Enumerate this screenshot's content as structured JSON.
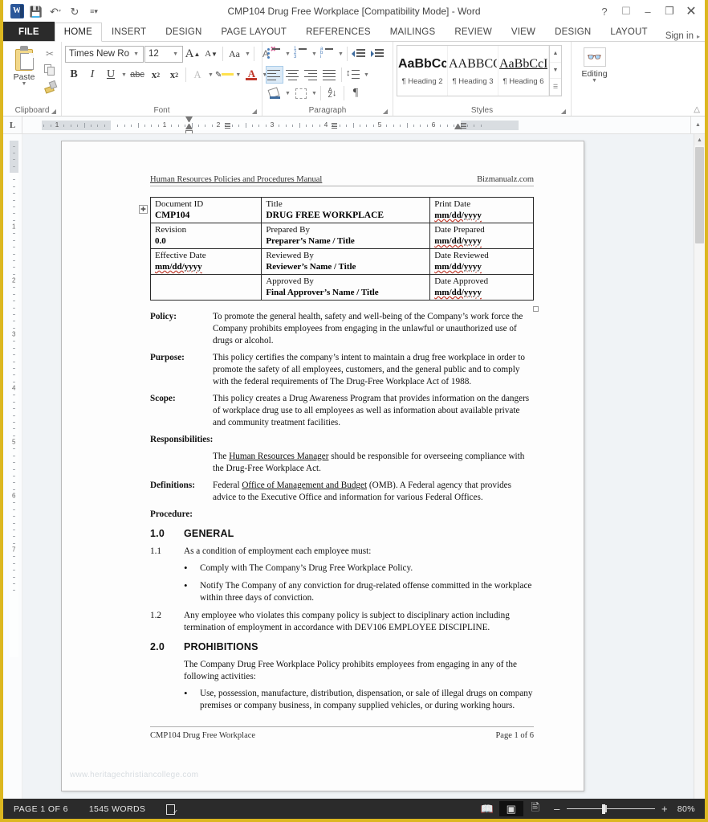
{
  "window": {
    "title": "CMP104 Drug Free Workplace [Compatibility Mode] - Word",
    "qat": {
      "logo": "word-logo",
      "save": "save-icon",
      "undo": "undo-icon",
      "redo": "redo-icon",
      "customize": "customize-qat-icon"
    },
    "controls": {
      "help": "?",
      "ribbon_display": "ribbon-display-options-icon",
      "minimize": "–",
      "restore": "restore-icon",
      "close": "✕"
    }
  },
  "tabs": [
    {
      "label": "FILE",
      "id": "file"
    },
    {
      "label": "HOME",
      "id": "home"
    },
    {
      "label": "INSERT",
      "id": "insert"
    },
    {
      "label": "DESIGN",
      "id": "design"
    },
    {
      "label": "PAGE LAYOUT",
      "id": "page-layout"
    },
    {
      "label": "REFERENCES",
      "id": "references"
    },
    {
      "label": "MAILINGS",
      "id": "mailings"
    },
    {
      "label": "REVIEW",
      "id": "review"
    },
    {
      "label": "VIEW",
      "id": "view"
    },
    {
      "label": "DESIGN",
      "id": "table-design"
    },
    {
      "label": "LAYOUT",
      "id": "table-layout"
    }
  ],
  "active_tab": "HOME",
  "signin": "Sign in",
  "ribbon": {
    "clipboard": {
      "label": "Clipboard",
      "paste": "Paste",
      "cut": "cut-icon",
      "copy": "copy-icon",
      "format_painter": "format-painter-icon"
    },
    "font": {
      "label": "Font",
      "font_name": "Times New Ro",
      "font_size": "12",
      "grow": "A",
      "shrink": "A",
      "change_case": "Aa",
      "clear_formatting": "clear-formatting-icon",
      "bold": "B",
      "italic": "I",
      "underline": "U",
      "strikethrough": "abc",
      "subscript": "x",
      "superscript": "x",
      "text_effects": "A",
      "highlight": "highlight-icon",
      "font_color": "A"
    },
    "paragraph": {
      "label": "Paragraph",
      "bullets": "bullets-icon",
      "numbering": "numbering-icon",
      "multilevel": "multilevel-list-icon",
      "decrease_indent": "decrease-indent-icon",
      "increase_indent": "increase-indent-icon",
      "align_left": "align-left-icon",
      "align_center": "align-center-icon",
      "align_right": "align-right-icon",
      "justify": "justify-icon",
      "line_spacing": "line-spacing-icon",
      "shading": "shading-icon",
      "borders": "borders-icon",
      "sort": "sort-icon",
      "show_marks": "¶"
    },
    "styles": {
      "label": "Styles",
      "items": [
        {
          "preview": "AaBbCc",
          "name": "¶ Heading 2"
        },
        {
          "preview": "AABBCC",
          "name": "¶ Heading 3"
        },
        {
          "preview": "AaBbCcI",
          "name": "¶ Heading 6"
        }
      ]
    },
    "editing": {
      "label": "Editing",
      "icon": "find-binoculars-icon"
    },
    "collapse": "collapse-ribbon-icon"
  },
  "ruler": {
    "tab_selector": "L",
    "h_numbers": [
      "1",
      "1",
      "2",
      "3",
      "4",
      "5"
    ],
    "v_numbers": [
      "1",
      "1",
      "2",
      "3",
      "4",
      "5",
      "6",
      "7",
      "8"
    ]
  },
  "document": {
    "header": {
      "left": "Human Resources Policies and Procedures Manual",
      "right": "Bizmanualz.com"
    },
    "watermark": "www.heritagechristiancollege.com",
    "table": [
      [
        {
          "label": "Document ID",
          "value": "CMP104"
        },
        {
          "label": "Title",
          "value": "DRUG FREE WORKPLACE"
        },
        {
          "label": "Print Date",
          "value": "mm/dd/yyyy"
        }
      ],
      [
        {
          "label": "Revision",
          "value": "0.0"
        },
        {
          "label": "Prepared By",
          "value": "Preparer’s Name / Title"
        },
        {
          "label": "Date Prepared",
          "value": "mm/dd/yyyy"
        }
      ],
      [
        {
          "label": "Effective Date",
          "value": "mm/dd/yyyy"
        },
        {
          "label": "Reviewed By",
          "value": "Reviewer’s Name / Title"
        },
        {
          "label": "Date Reviewed",
          "value": "mm/dd/yyyy"
        }
      ],
      [
        {
          "label": "",
          "value": ""
        },
        {
          "label": "Approved By",
          "value": "Final Approver’s Name / Title"
        },
        {
          "label": "Date Approved",
          "value": "mm/dd/yyyy"
        }
      ]
    ],
    "sections": {
      "policy_label": "Policy:",
      "policy_text": "To promote the general health, safety and well-being of the Company’s work force the Company prohibits employees from engaging in the unlawful or unauthorized use of drugs or alcohol.",
      "purpose_label": "Purpose:",
      "purpose_text": "This policy certifies the company’s intent to maintain a drug free workplace in order to promote the safety of all employees, customers, and the general public and to comply with the federal requirements of The Drug-Free Workplace Act of 1988.",
      "scope_label": "Scope:",
      "scope_text": "This policy creates a Drug Awareness Program that provides information on the dangers of workplace drug use to all employees as well as information about available private and community treatment facilities.",
      "responsibilities_label": "Responsibilities:",
      "responsibilities_pre": "The ",
      "responsibilities_link": "Human Resources Manager",
      "responsibilities_post": " should be responsible for overseeing compliance with the Drug-Free Workplace Act.",
      "definitions_label": "Definitions:",
      "definitions_pre": "Federal ",
      "definitions_link": "Office of Management and Budget",
      "definitions_post": " (OMB). A Federal agency that provides advice to the Executive Office and information for various Federal Offices.",
      "procedure_label": "Procedure:",
      "h1_num": "1.0",
      "h1_title": "GENERAL",
      "p11_num": "1.1",
      "p11_text": "As a condition of employment each employee must:",
      "bullet_1": "Comply with The Company’s Drug Free Workplace Policy.",
      "bullet_2": "Notify The Company of any conviction for drug-related offense committed in the workplace within three days of conviction.",
      "p12_num": "1.2",
      "p12_text": "Any employee who violates this company policy is subject to disciplinary action including termination of employment in accordance with DEV106 EMPLOYEE DISCIPLINE.",
      "h2_num": "2.0",
      "h2_title": "PROHIBITIONS",
      "p20_text": "The Company Drug Free Workplace Policy prohibits employees from engaging in any of the following activities:",
      "bullet_3": "Use, possession, manufacture, distribution, dispensation, or sale of illegal drugs on company premises or company business, in company supplied vehicles, or during working hours."
    },
    "footer": {
      "left": "CMP104 Drug Free Workplace",
      "right": "Page 1 of 6"
    }
  },
  "statusbar": {
    "page": "PAGE 1 OF 6",
    "words": "1545 WORDS",
    "proofing": "proofing-errors-icon",
    "views": [
      {
        "id": "read-mode",
        "icon": "read-mode-icon",
        "active": false
      },
      {
        "id": "print-layout",
        "icon": "print-layout-icon",
        "active": true
      },
      {
        "id": "web-layout",
        "icon": "web-layout-icon",
        "active": false
      }
    ],
    "zoom_out": "–",
    "zoom_in": "+",
    "zoom_level": "80%"
  },
  "colors": {
    "accent": "#dcb720",
    "word_blue": "#2b579a",
    "status_bg": "#2b2b2b",
    "canvas_bg": "#f0f3f6"
  }
}
